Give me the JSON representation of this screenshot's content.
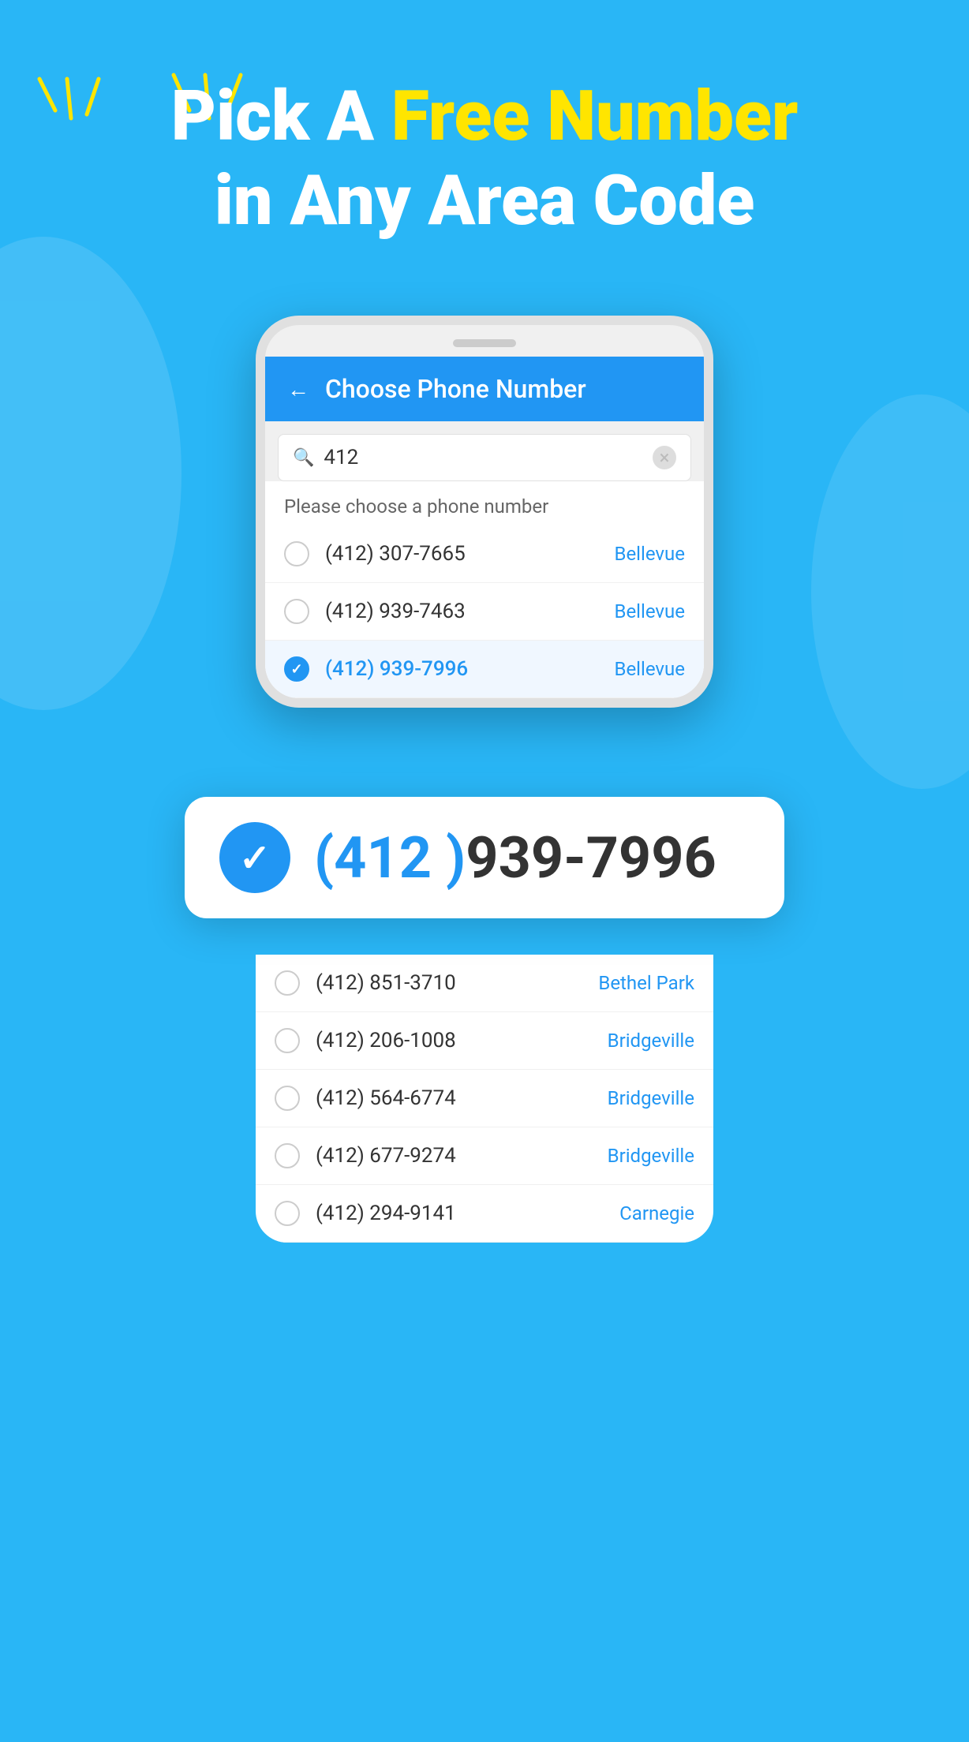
{
  "background_color": "#29b6f6",
  "sparkles": {
    "color": "#FFE500"
  },
  "hero": {
    "line1_plain": "Pick A ",
    "line1_highlight": "Free Number",
    "line2": "in Any Area Code"
  },
  "phone_screen": {
    "header": {
      "title": "Choose Phone Number",
      "back_label": "←"
    },
    "search": {
      "value": "412",
      "placeholder": "412",
      "clear_label": "×"
    },
    "instruction": "Please choose a phone number",
    "numbers": [
      {
        "number": "(412) 307-7665",
        "city": "Bellevue",
        "selected": false
      },
      {
        "number": "(412) 939-7463",
        "city": "Bellevue",
        "selected": false
      },
      {
        "number": "(412) 939-7996",
        "city": "Bellevue",
        "selected": true
      },
      {
        "number": "(412) 851-3710",
        "city": "Bethel Park",
        "selected": false
      },
      {
        "number": "(412) 206-1008",
        "city": "Bridgeville",
        "selected": false
      },
      {
        "number": "(412) 564-6774",
        "city": "Bridgeville",
        "selected": false
      },
      {
        "number": "(412) 677-9274",
        "city": "Bridgeville",
        "selected": false
      },
      {
        "number": "(412) 294-9141",
        "city": "Carnegie",
        "selected": false
      }
    ]
  },
  "callout": {
    "check_icon": "✓",
    "area_code": "(412 )",
    "number_rest": "939-7996"
  }
}
